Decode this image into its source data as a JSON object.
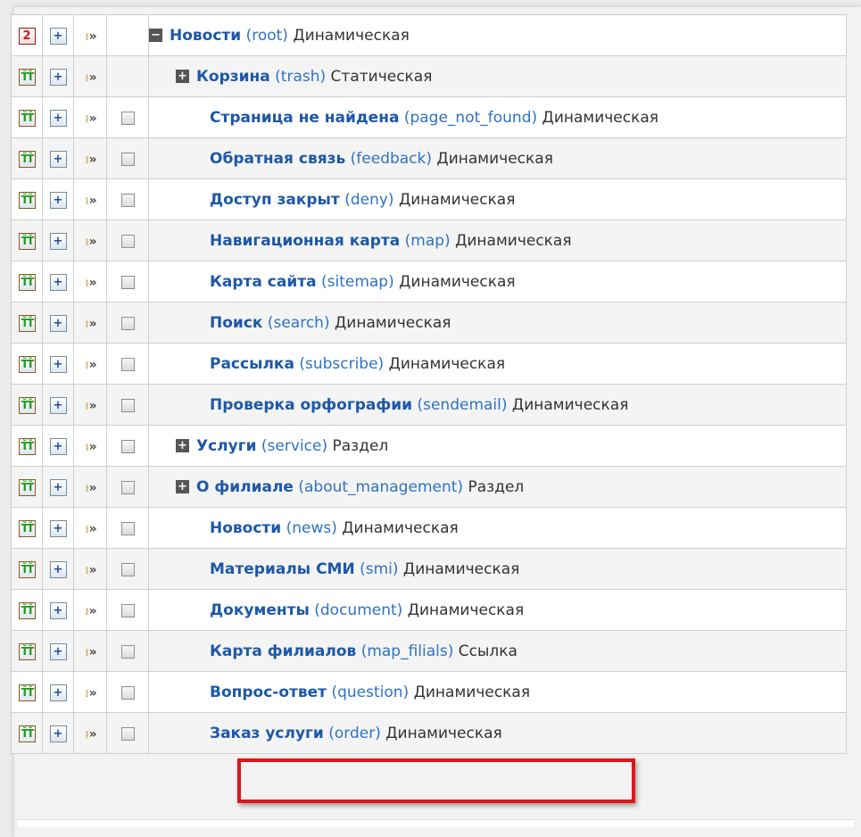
{
  "rows": [
    {
      "first_icon": "refresh-icon",
      "toggle": "minus",
      "level": 0,
      "checkbox": false,
      "title": "Новости",
      "slug": "(root)",
      "type": "Динамическая"
    },
    {
      "first_icon": "add-child-icon",
      "toggle": "plus",
      "level": 1,
      "checkbox": false,
      "title": "Корзина",
      "slug": "(trash)",
      "type": "Статическая"
    },
    {
      "first_icon": "add-child-icon",
      "toggle": "none",
      "level": 1,
      "checkbox": true,
      "title": "Страница не найдена",
      "slug": "(page_not_found)",
      "type": "Динамическая"
    },
    {
      "first_icon": "add-child-icon",
      "toggle": "none",
      "level": 1,
      "checkbox": true,
      "title": "Обратная связь",
      "slug": "(feedback)",
      "type": "Динамическая"
    },
    {
      "first_icon": "add-child-icon",
      "toggle": "none",
      "level": 1,
      "checkbox": true,
      "title": "Доступ закрыт",
      "slug": "(deny)",
      "type": "Динамическая"
    },
    {
      "first_icon": "add-child-icon",
      "toggle": "none",
      "level": 1,
      "checkbox": true,
      "title": "Навигационная карта",
      "slug": "(map)",
      "type": "Динамическая"
    },
    {
      "first_icon": "add-child-icon",
      "toggle": "none",
      "level": 1,
      "checkbox": true,
      "title": "Карта сайта",
      "slug": "(sitemap)",
      "type": "Динамическая"
    },
    {
      "first_icon": "add-child-icon",
      "toggle": "none",
      "level": 1,
      "checkbox": true,
      "title": "Поиск",
      "slug": "(search)",
      "type": "Динамическая"
    },
    {
      "first_icon": "add-child-icon",
      "toggle": "none",
      "level": 1,
      "checkbox": true,
      "title": "Рассылка",
      "slug": "(subscribe)",
      "type": "Динамическая"
    },
    {
      "first_icon": "add-child-icon",
      "toggle": "none",
      "level": 1,
      "checkbox": true,
      "title": "Проверка орфографии",
      "slug": "(sendemail)",
      "type": "Динамическая"
    },
    {
      "first_icon": "add-child-icon",
      "toggle": "plus",
      "level": 1,
      "checkbox": true,
      "title": "Услуги",
      "slug": "(service)",
      "type": "Раздел"
    },
    {
      "first_icon": "add-child-icon",
      "toggle": "plus",
      "level": 1,
      "checkbox": true,
      "title": "О филиале",
      "slug": "(about_management)",
      "type": "Раздел"
    },
    {
      "first_icon": "add-child-icon",
      "toggle": "none",
      "level": 1,
      "checkbox": true,
      "title": "Новости",
      "slug": "(news)",
      "type": "Динамическая"
    },
    {
      "first_icon": "add-child-icon",
      "toggle": "none",
      "level": 1,
      "checkbox": true,
      "title": "Материалы СМИ",
      "slug": "(smi)",
      "type": "Динамическая"
    },
    {
      "first_icon": "add-child-icon",
      "toggle": "none",
      "level": 1,
      "checkbox": true,
      "title": "Документы",
      "slug": "(document)",
      "type": "Динамическая"
    },
    {
      "first_icon": "add-child-icon",
      "toggle": "none",
      "level": 1,
      "checkbox": true,
      "title": "Карта филиалов",
      "slug": "(map_filials)",
      "type": "Ссылка"
    },
    {
      "first_icon": "add-child-icon",
      "toggle": "none",
      "level": 1,
      "checkbox": true,
      "title": "Вопрос-ответ",
      "slug": "(question)",
      "type": "Динамическая"
    },
    {
      "first_icon": "add-child-icon",
      "toggle": "none",
      "level": 1,
      "checkbox": true,
      "title": "Заказ услуги",
      "slug": "(order)",
      "type": "Динамическая"
    }
  ],
  "colors": {
    "title": "#1d58a8",
    "highlight": "#e0141a"
  },
  "toggle_glyphs": {
    "minus": "−",
    "plus": "+"
  },
  "icon_glyphs": {
    "refresh-icon": "2",
    "add-child-icon": "ŤŤ",
    "add-sibling-icon": "+",
    "move-icon": "»"
  }
}
